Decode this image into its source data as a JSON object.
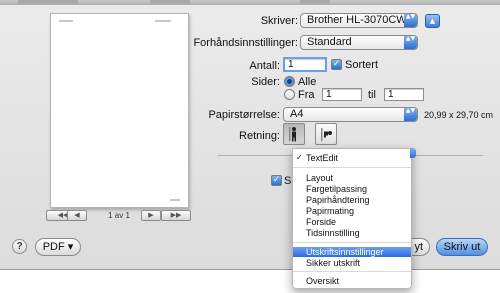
{
  "printer": {
    "label": "Skriver:",
    "value": "Brother HL-3070CW s..."
  },
  "presets": {
    "label": "Forhåndsinnstillinger:",
    "value": "Standard"
  },
  "copies": {
    "label": "Antall:",
    "value": "1",
    "collated_label": "Sortert"
  },
  "pages": {
    "label": "Sider:",
    "all_label": "Alle",
    "from_label": "Fra",
    "from_value": "1",
    "to_label": "til",
    "to_value": "1"
  },
  "paper_size": {
    "label": "Papirstørrelse:",
    "value": "A4",
    "dimensions": "20,99 x 29,70 cm"
  },
  "orientation": {
    "label": "Retning:"
  },
  "preview": {
    "page_indicator": "1 av 1"
  },
  "menu": {
    "selected": "TextEdit",
    "group1": [
      "Layout",
      "Fargetilpassing",
      "Papirhåndtering",
      "Papirmating",
      "Forside",
      "Tidsinnstilling"
    ],
    "group2": [
      "Utskriftsinnstillinger",
      "Sikker utskrift"
    ],
    "group3": [
      "Oversikt"
    ],
    "highlighted": "Utskriftsinnstillinger"
  },
  "hidden_fragments": {
    "checkbox_label_start": "Sk",
    "cancel_fragment": "yt"
  },
  "bottom": {
    "pdf_label": "PDF ▾",
    "print_label": "Skriv ut",
    "help": "?"
  },
  "icons": {
    "check": "✓",
    "stepper": "▲▼",
    "disclosure": "▲",
    "nav_first": "◀◀",
    "nav_prev": "◀",
    "nav_next": "▶",
    "nav_last": "▶▶"
  },
  "colors": {
    "accent": "#2d6be0",
    "dialog_bg": "#e4e4e4"
  }
}
